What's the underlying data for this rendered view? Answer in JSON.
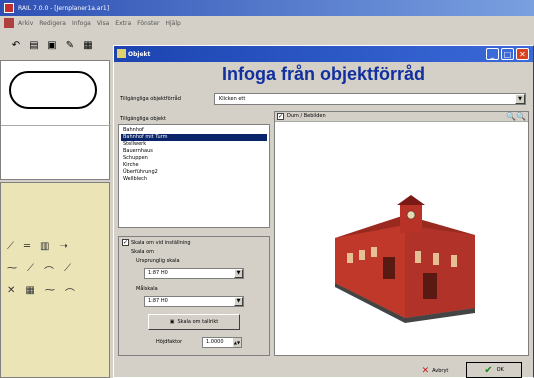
{
  "app": {
    "title": "RAIL 7.0.0 - [Jernplaner1a.ar1]",
    "menu": [
      "Arkiv",
      "Redigera",
      "Infoga",
      "Visa",
      "Extra",
      "Fönster",
      "Hjälp"
    ]
  },
  "dialog": {
    "title": "Objekt",
    "heading": "Infoga från objektförråd",
    "source_label": "Tillgängliga objektförråd",
    "source_value": "Klicken ett",
    "list_label": "Tillgängliga objekt",
    "objects": [
      "Bahnhof",
      "Bahnhof mit Turm",
      "Stellwerk",
      "Bauernhaus",
      "Schuppen",
      "Kirche",
      "Überführung2",
      "Wellblech"
    ],
    "selected_index": 1,
    "scale_checkbox_label": "Skala om vid inställning",
    "scale_heading": "Skala om",
    "original_scale_label": "Ursprunglig skala",
    "original_scale_value": "1:87 H0",
    "target_scale_label": "Målskala",
    "target_scale_value": "1:87 H0",
    "reverse_button": "Skala om tallrikt",
    "height_label": "Höjdfaktor",
    "height_value": "1.0000",
    "preview_label": "Dum / Bebilden",
    "cancel_label": "Avbryt",
    "ok_label": "OK"
  },
  "colors": {
    "title_blue": "#1c44b0",
    "heading_blue": "#1030a0",
    "selection": "#0a246a",
    "panel_yellow": "#eae4b6",
    "building_red": "#c0382a"
  }
}
